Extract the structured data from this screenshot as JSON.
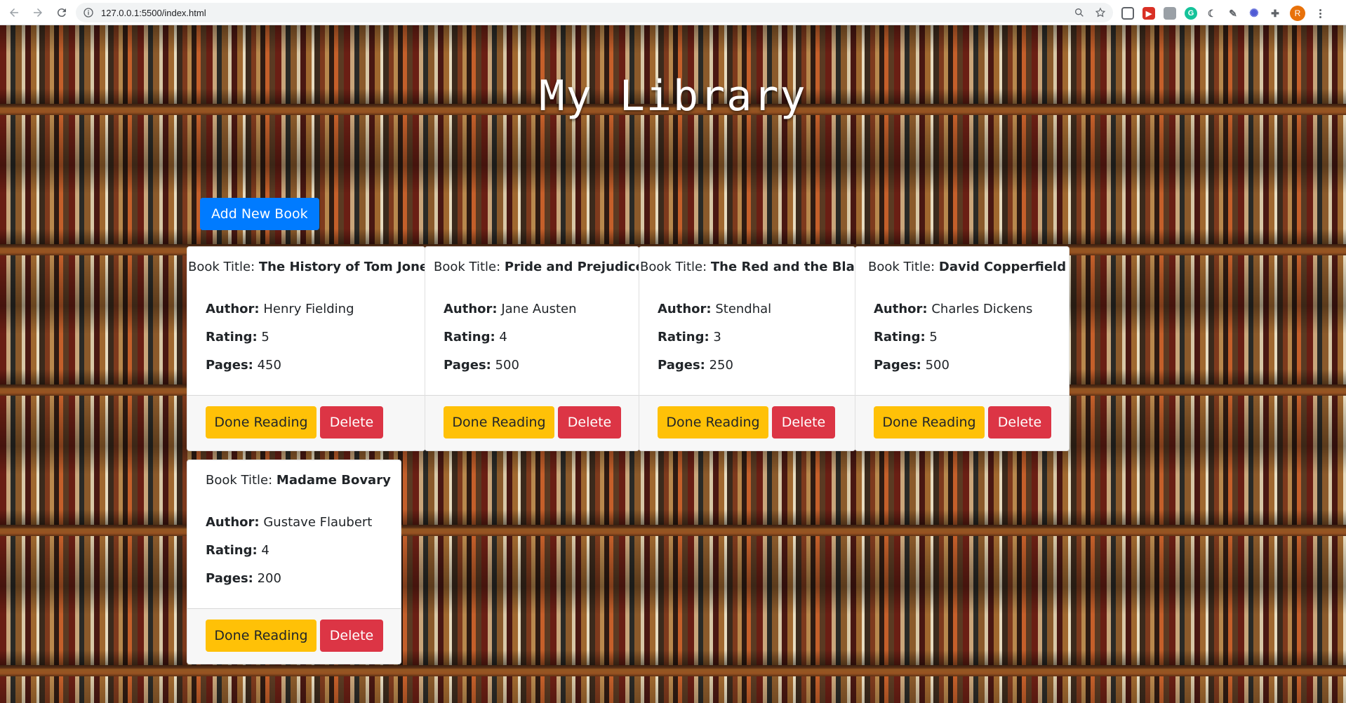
{
  "browser": {
    "url": "127.0.0.1:5500/index.html",
    "profile_initial": "R"
  },
  "page": {
    "title": "My Library",
    "add_button_label": "Add New Book"
  },
  "labels": {
    "book_title": "Book Title:",
    "author": "Author:",
    "rating": "Rating:",
    "pages": "Pages:",
    "done_button": "Done Reading",
    "delete_button": "Delete"
  },
  "books": [
    {
      "title": "The History of Tom Jones",
      "author": "Henry Fielding",
      "rating": "5",
      "pages": "450"
    },
    {
      "title": "Pride and Prejudice",
      "author": "Jane Austen",
      "rating": "4",
      "pages": "500"
    },
    {
      "title": "The Red and the Black",
      "author": "Stendhal",
      "rating": "3",
      "pages": "250"
    },
    {
      "title": "David Copperfield",
      "author": "Charles Dickens",
      "rating": "5",
      "pages": "500"
    },
    {
      "title": "Madame Bovary",
      "author": "Gustave Flaubert",
      "rating": "4",
      "pages": "200"
    }
  ],
  "colors": {
    "primary": "#007bff",
    "warning": "#ffc107",
    "danger": "#dc3545"
  }
}
